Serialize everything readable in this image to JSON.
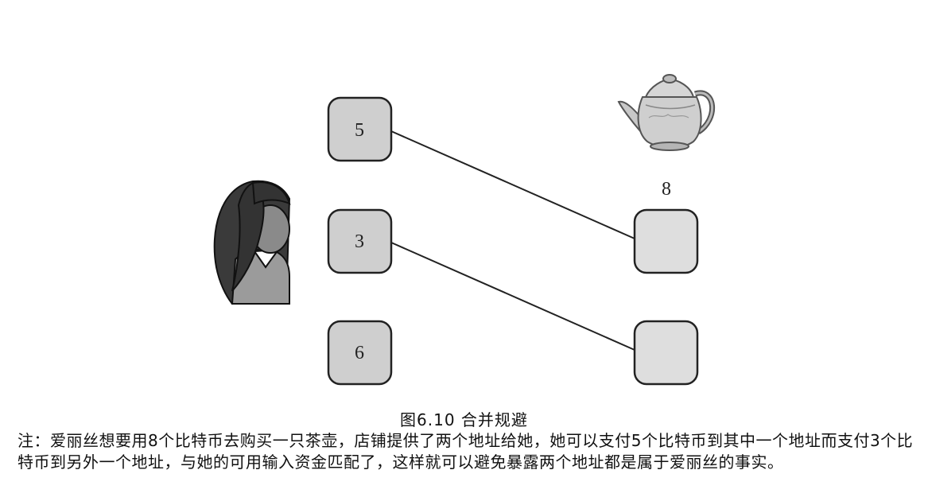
{
  "figure": {
    "caption": "图6.10 合并规避",
    "note": "注：爱丽丝想要用8个比特币去购买一只茶壶，店铺提供了两个地址给她，她可以支付5个比特币到其中一个地址而支付3个比特币到另外一个地址，与她的可用输入资金匹配了，这样就可以避免暴露两个地址都是属于爱丽丝的事实。"
  },
  "inputs": [
    {
      "value": "5"
    },
    {
      "value": "3"
    },
    {
      "value": "6"
    }
  ],
  "outputs": [
    {
      "label": ""
    },
    {
      "label": ""
    }
  ],
  "price": {
    "value": "8"
  },
  "icons": {
    "person": "woman-avatar-icon",
    "item": "teapot-icon"
  },
  "colors": {
    "input_box": "#cfcfcf",
    "output_box": "#dedede",
    "box_stroke": "#222222",
    "figure_fill": "#8f8f8f"
  }
}
